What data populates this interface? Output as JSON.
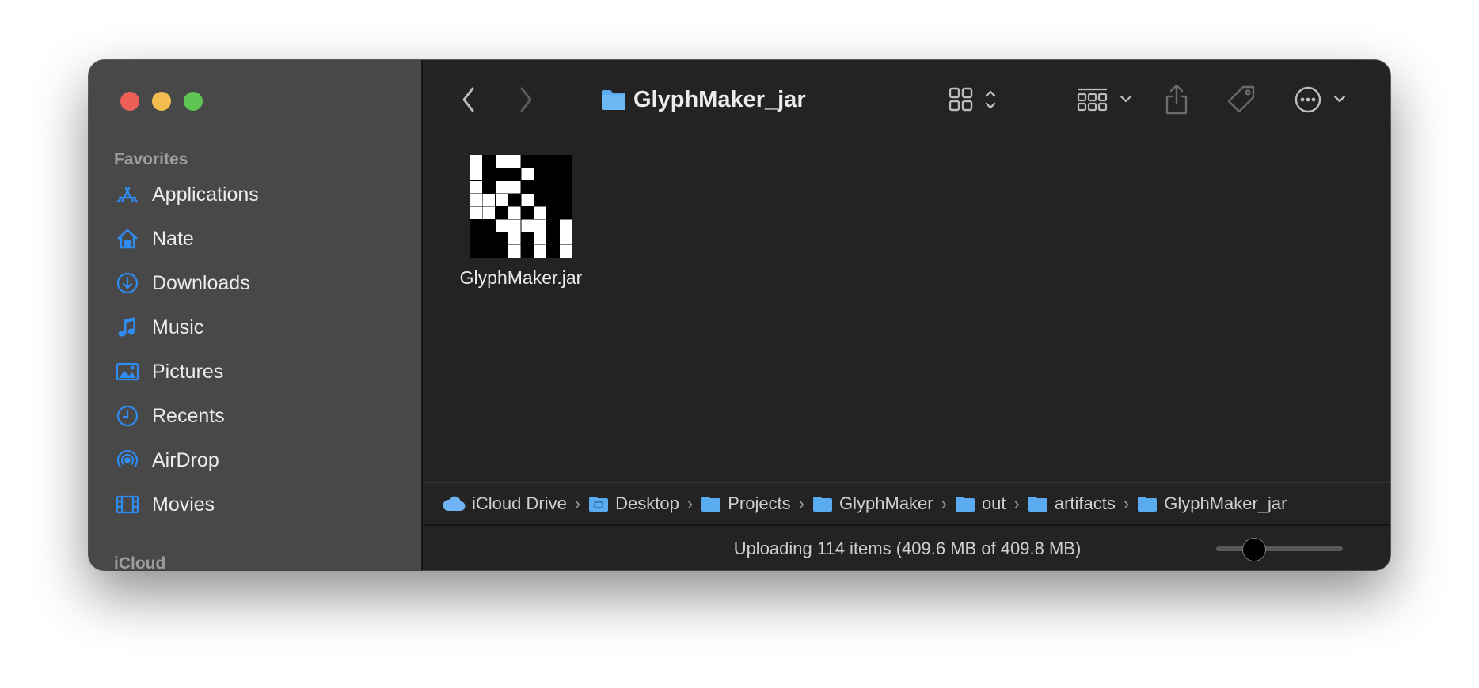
{
  "window": {
    "title": "GlyphMaker_jar"
  },
  "sidebar": {
    "favorites_header": "Favorites",
    "items": [
      {
        "label": "Applications",
        "icon": "applications-icon"
      },
      {
        "label": "Nate",
        "icon": "home-icon"
      },
      {
        "label": "Downloads",
        "icon": "downloads-icon"
      },
      {
        "label": "Music",
        "icon": "music-icon"
      },
      {
        "label": "Pictures",
        "icon": "pictures-icon"
      },
      {
        "label": "Recents",
        "icon": "recents-icon"
      },
      {
        "label": "AirDrop",
        "icon": "airdrop-icon"
      },
      {
        "label": "Movies",
        "icon": "movies-icon"
      }
    ],
    "icloud_header": "iCloud"
  },
  "toolbar": {
    "back_icon": "chevron-left-icon",
    "forward_icon": "chevron-right-icon",
    "view_icon": "icon-grid-view-icon",
    "group_icon": "group-by-icon",
    "share_icon": "share-icon",
    "tag_icon": "tag-icon",
    "more_icon": "ellipsis-circle-icon",
    "search_icon": "search-icon"
  },
  "files": [
    {
      "name": "GlyphMaker.jar",
      "icon": "jar-file-icon"
    }
  ],
  "pathbar": {
    "crumbs": [
      "iCloud Drive",
      "Desktop",
      "Projects",
      "GlyphMaker",
      "out",
      "artifacts",
      "GlyphMaker_jar"
    ]
  },
  "status": {
    "text": "Uploading 114 items (409.6 MB of 409.8 MB)",
    "icon_size_slider": 0.3
  },
  "colors": {
    "accent": "#2f8cf2",
    "folder": "#5aabf0",
    "sidebar_bg": "#484848",
    "content_bg": "#232323",
    "close": "#ec5f57",
    "minimize": "#f4bd4f",
    "zoom": "#5fc553"
  }
}
